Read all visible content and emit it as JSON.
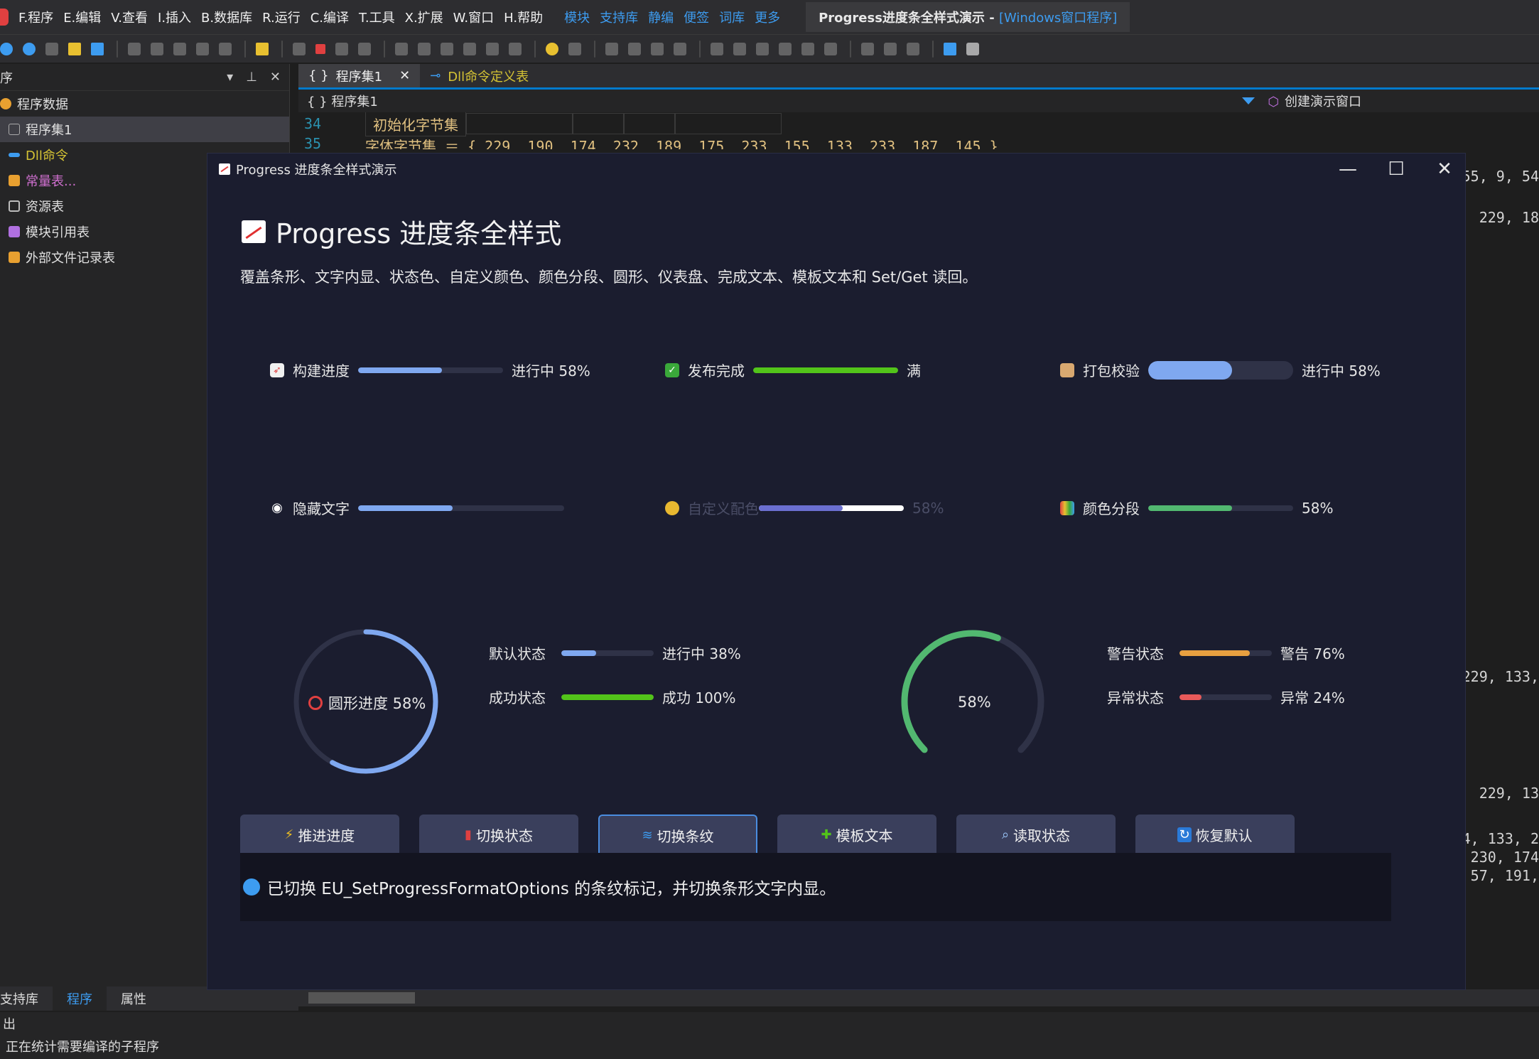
{
  "ide": {
    "menu": [
      "F.程序",
      "E.编辑",
      "V.查看",
      "I.插入",
      "B.数据库",
      "R.运行",
      "C.编译",
      "T.工具",
      "X.扩展",
      "W.窗口",
      "H.帮助"
    ],
    "quick_links": [
      "模块",
      "支持库",
      "静编",
      "便签",
      "词库",
      "更多"
    ],
    "window_title_prefix": "Progress进度条全样式演示 - ",
    "window_title_suffix": "[Windows窗口程序]",
    "left_panel": {
      "header": "序",
      "items": [
        {
          "label": "程序数据"
        },
        {
          "label": "程序集1"
        },
        {
          "label": "Dll命令"
        },
        {
          "label": "常量表..."
        },
        {
          "label": "资源表"
        },
        {
          "label": "模块引用表"
        },
        {
          "label": "外部文件记录表"
        }
      ]
    },
    "tabs": {
      "active": "程序集1",
      "inactive": "Dll命令定义表"
    },
    "path": {
      "left": "{ } 程序集1",
      "right": "创建演示窗口"
    },
    "code": {
      "line34_num": "34",
      "line34_text": "初始化字节集",
      "line35_num": "35",
      "line35_text": "字体字节集 ＝ { 229, 190, 174, 232, 189, 175, 233, 155, 133, 233, 187, 145 }",
      "right_lines": [
        "55, 9, 54",
        "229, 18",
        "229, 133,",
        "229, 13",
        "4, 133, 2",
        "230, 174",
        "57, 191,"
      ]
    },
    "bottom_tabs": [
      "支持库",
      "程序",
      "属性"
    ],
    "output": {
      "header": "出",
      "message": "正在统计需要编译的子程序"
    }
  },
  "dialog": {
    "title": "Progress 进度条全样式演示",
    "controls": {
      "minimize": "—",
      "maximize": "☐",
      "close": "✕"
    },
    "heading": "Progress 进度条全样式",
    "subtitle": "覆盖条形、文字内显、状态色、自定义颜色、颜色分段、圆形、仪表盘、完成文本、模板文本和 Set/Get 读回。",
    "bars": [
      {
        "label": "构建进度",
        "value": 0.58,
        "text": "进行中 58%",
        "color": "#7fa8f0",
        "icon": "rocket-icon"
      },
      {
        "label": "发布完成",
        "value": 1.0,
        "text": "满",
        "color": "#52c41a",
        "icon": "check-icon"
      },
      {
        "label": "打包校验",
        "value": 0.58,
        "text": "进行中 58%",
        "color": "#7fa8f0",
        "icon": "package-icon"
      },
      {
        "label": "隐藏文字",
        "value": 0.46,
        "text": "",
        "color": "#7fa8f0",
        "icon": "eye-icon"
      },
      {
        "label": "自定义配色",
        "value": 0.58,
        "text": "58%",
        "color": "#6b6fd0",
        "icon": "palette-icon"
      },
      {
        "label": "颜色分段",
        "value": 0.58,
        "text": "58%",
        "color": "#52b870",
        "icon": "rainbow-icon"
      }
    ],
    "circle": {
      "label": "圆形进度 58%",
      "value": 0.58,
      "color": "#7fa8f0"
    },
    "dashboard": {
      "label": "58%",
      "value": 0.58,
      "color": "#52b870"
    },
    "status_bars": [
      {
        "label": "默认状态",
        "value": 0.38,
        "text": "进行中 38%",
        "color": "#7fa8f0"
      },
      {
        "label": "成功状态",
        "value": 1.0,
        "text": "成功 100%",
        "color": "#52c41a"
      },
      {
        "label": "警告状态",
        "value": 0.76,
        "text": "警告 76%",
        "color": "#e8a040"
      },
      {
        "label": "异常状态",
        "value": 0.24,
        "text": "异常 24%",
        "color": "#e85a5a"
      }
    ],
    "buttons": [
      {
        "label": "推进进度",
        "icon": "lightning-icon"
      },
      {
        "label": "切换状态",
        "icon": "traffic-light-icon"
      },
      {
        "label": "切换条纹",
        "icon": "wave-icon"
      },
      {
        "label": "模板文本",
        "icon": "puzzle-icon"
      },
      {
        "label": "读取状态",
        "icon": "magnifier-icon"
      },
      {
        "label": "恢复默认",
        "icon": "refresh-icon"
      }
    ],
    "status_message": "已切换 EU_SetProgressFormatOptions 的条纹标记，并切换条形文字内显。"
  }
}
